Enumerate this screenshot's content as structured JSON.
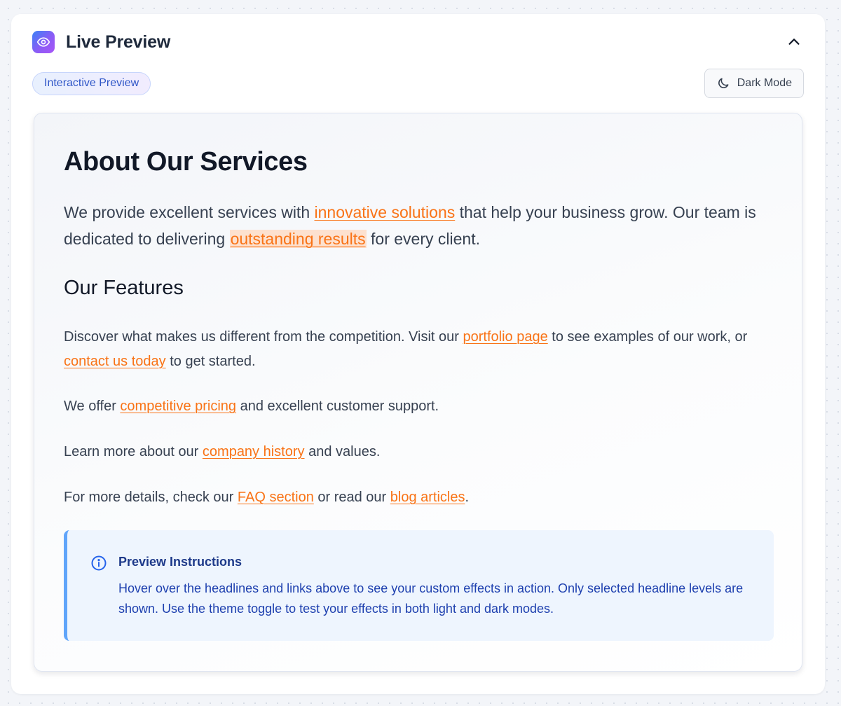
{
  "panel": {
    "title": "Live Preview",
    "header_icon": "eye-icon",
    "collapse_icon": "chevron-up-icon"
  },
  "toolbar": {
    "badge": "Interactive Preview",
    "theme_button": "Dark Mode",
    "theme_icon": "moon-icon"
  },
  "preview": {
    "headline": "About Our Services",
    "intro": [
      {
        "text": "We provide excellent services with "
      },
      {
        "link": "innovative solutions"
      },
      {
        "text": " that help your business grow. Our team is dedicated to delivering "
      },
      {
        "link": "outstanding results",
        "highlight": true
      },
      {
        "text": " for every client."
      }
    ],
    "subheadline": "Our Features",
    "paragraphs": [
      [
        {
          "text": "Discover what makes us different from the competition. Visit our "
        },
        {
          "link": "portfolio page"
        },
        {
          "text": " to see examples of our work, or "
        },
        {
          "link": "contact us today"
        },
        {
          "text": " to get started."
        }
      ],
      [
        {
          "text": "We offer "
        },
        {
          "link": "competitive pricing"
        },
        {
          "text": " and excellent customer support."
        }
      ],
      [
        {
          "text": "Learn more about our "
        },
        {
          "link": "company history"
        },
        {
          "text": " and values."
        }
      ],
      [
        {
          "text": "For more details, check our "
        },
        {
          "link": "FAQ section"
        },
        {
          "text": " or read our "
        },
        {
          "link": "blog articles"
        },
        {
          "text": "."
        }
      ]
    ]
  },
  "info": {
    "icon": "info-icon",
    "title": "Preview Instructions",
    "text": "Hover over the headlines and links above to see your custom effects in action. Only selected headline levels are shown. Use the theme toggle to test your effects in both light and dark modes."
  },
  "colors": {
    "accent_link": "#f97316",
    "link_highlight": "#fde1cf",
    "info_border": "#60a5fa",
    "info_bg": "#eef5fe",
    "badge_text": "#2f56c7"
  }
}
